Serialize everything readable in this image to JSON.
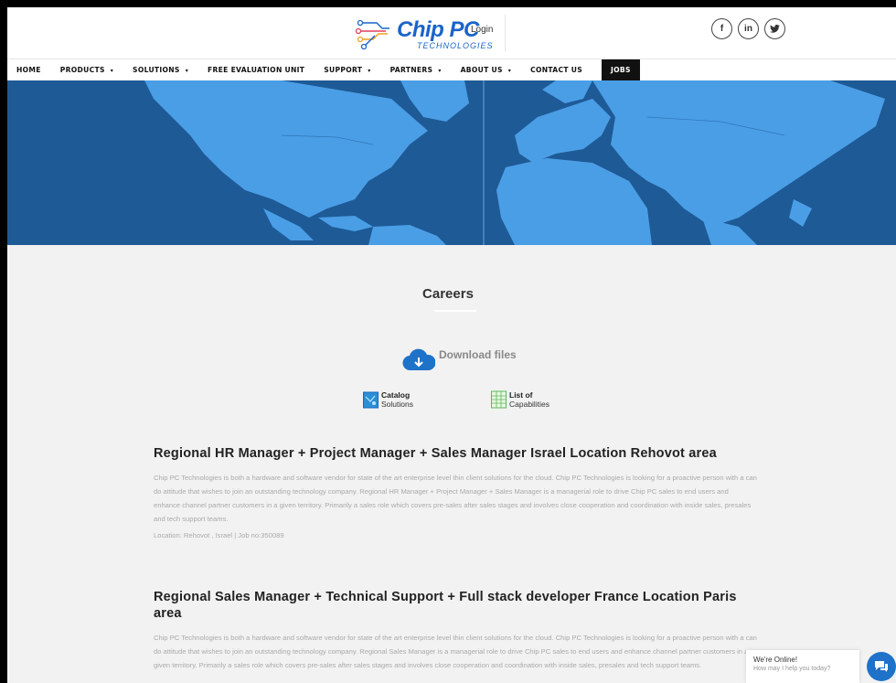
{
  "header": {
    "logo_name": "Chip PC",
    "logo_sub": "TECHNOLOGIES",
    "login": "Login",
    "socials": [
      {
        "icon": "facebook-icon",
        "glyph": "f"
      },
      {
        "icon": "linkedin-icon",
        "glyph": "in"
      },
      {
        "icon": "twitter-icon",
        "glyph": "🐦"
      }
    ]
  },
  "nav": {
    "items": [
      {
        "label": "HOME",
        "dropdown": false
      },
      {
        "label": "PRODUCTS",
        "dropdown": true
      },
      {
        "label": "SOLUTIONS",
        "dropdown": true
      },
      {
        "label": "FREE EVALUATION UNIT",
        "dropdown": false
      },
      {
        "label": "SUPPORT",
        "dropdown": true
      },
      {
        "label": "PARTNERS",
        "dropdown": true
      },
      {
        "label": "ABOUT US",
        "dropdown": true
      },
      {
        "label": "CONTACT US",
        "dropdown": false
      },
      {
        "label": "JOBS",
        "dropdown": false,
        "active": true
      }
    ],
    "caret": "▾"
  },
  "main": {
    "title": "Careers",
    "download_label": "Download files",
    "files": [
      {
        "line1": "Catalog",
        "line2": "Solutions"
      },
      {
        "line1": "List of",
        "line2": "Capabilities"
      }
    ],
    "jobs": [
      {
        "title": "Regional HR Manager + Project Manager + Sales Manager Israel Location Rehovot area",
        "description": "Chip PC Technologies is both a hardware and software vendor for state of the art enterprise level thin client solutions for the cloud. Chip PC Technologies is looking for a proactive person with a can do attitude that wishes to join an outstanding technology company. Regional HR Manager + Project Manager + Sales Manager is a managerial role to drive Chip PC sales to end users and enhance channel partner customers in a given territory. Primarily a sales role which covers pre-sales after sales stages and involves close cooperation and coordination with inside sales, presales and tech support teams.",
        "meta": "Location: Rehovot , Israel    |  Job no:350089"
      },
      {
        "title": "Regional Sales Manager + Technical Support + Full stack developer France Location Paris area",
        "description": "Chip PC Technologies is both a hardware and software vendor for state of the art enterprise level thin client solutions for the cloud. Chip PC Technologies is looking for a proactive person with a can do attitude that wishes to join an outstanding technology company. Regional Sales Manager is a managerial role to drive Chip PC sales to end users and enhance channel partner customers in a given territory. Primarily a sales role which covers pre-sales after sales stages and involves close cooperation and coordination with inside sales, presales and tech support teams.",
        "meta": ""
      }
    ]
  },
  "chat": {
    "title": "We're Online!",
    "subtitle": "How may I help you today?"
  },
  "colors": {
    "ocean": "#1e5a96",
    "land": "#4a9ee6",
    "brand": "#1a64c8",
    "background": "#f2f2f2"
  }
}
